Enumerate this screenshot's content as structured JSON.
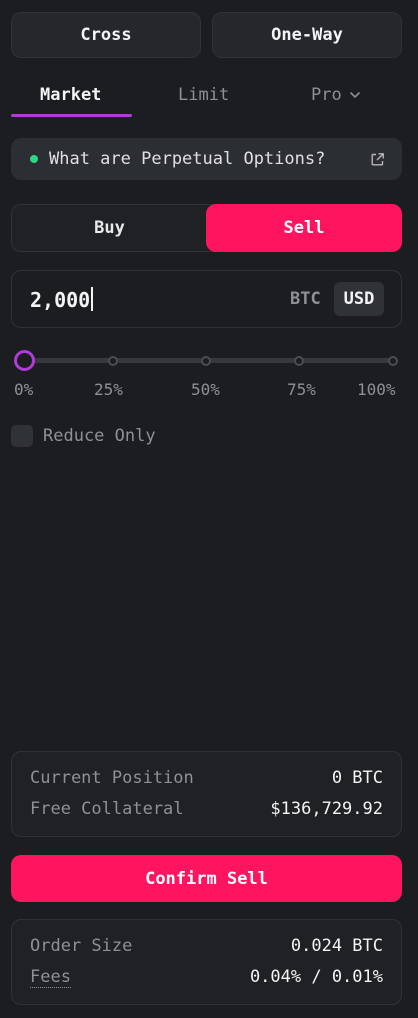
{
  "top_buttons": {
    "margin_mode": "Cross",
    "position_mode": "One-Way"
  },
  "tabs": {
    "market": "Market",
    "limit": "Limit",
    "pro": "Pro"
  },
  "banner": {
    "text": "What are Perpetual Options?",
    "icon": "external-link-icon"
  },
  "side": {
    "buy": "Buy",
    "sell": "Sell",
    "selected": "Sell"
  },
  "amount": {
    "value": "2,000",
    "unit_btc": "BTC",
    "unit_usd": "USD",
    "selected_unit": "USD"
  },
  "slider": {
    "value_percent": 0,
    "marks": [
      "0%",
      "25%",
      "50%",
      "75%",
      "100%"
    ]
  },
  "reduce_only": {
    "label": "Reduce Only",
    "checked": false
  },
  "position": {
    "current_position_label": "Current Position",
    "current_position_value": "0 BTC",
    "free_collateral_label": "Free Collateral",
    "free_collateral_value": "$136,729.92"
  },
  "confirm_label": "Confirm Sell",
  "order": {
    "order_size_label": "Order Size",
    "order_size_value": "0.024 BTC",
    "fees_label": "Fees",
    "fees_value": "0.04% / 0.01%"
  },
  "colors": {
    "accent_sell": "#ff1460",
    "accent_tab": "#b03bd8",
    "status_dot": "#2fd684"
  }
}
